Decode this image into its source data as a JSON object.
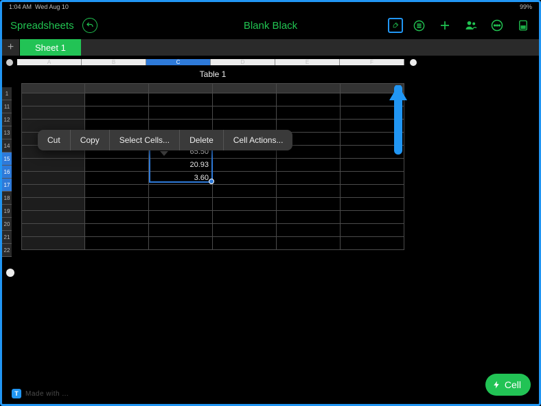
{
  "status": {
    "time": "1:04 AM",
    "date": "Wed Aug 10",
    "battery": "99%"
  },
  "toolbar": {
    "back_label": "Spreadsheets",
    "doc_title": "Blank Black",
    "icons": {
      "undo": "undo-icon",
      "brush": "brush-icon",
      "list": "list-icon",
      "add": "add-icon",
      "collab": "collab-icon",
      "more": "more-icon",
      "panel": "panel-icon"
    }
  },
  "sheet_tabs": {
    "add_label": "+",
    "tabs": [
      "Sheet 1"
    ]
  },
  "table": {
    "title": "Table 1"
  },
  "columns": [
    "A",
    "B",
    "C",
    "D",
    "E",
    "F"
  ],
  "active_column_index": 2,
  "rows": [
    "1",
    "11",
    "12",
    "13",
    "14",
    "15",
    "16",
    "17",
    "18",
    "19",
    "20",
    "21",
    "22"
  ],
  "active_row_indices": [
    5,
    6,
    7
  ],
  "cells": {
    "C15": "65.50",
    "C16": "20.93",
    "C17": "3.60"
  },
  "selection": {
    "col": "C",
    "start_row": "15",
    "end_row": "17"
  },
  "context_menu": [
    "Cut",
    "Copy",
    "Select Cells...",
    "Delete",
    "Cell Actions..."
  ],
  "fab": {
    "label": "Cell",
    "icon": "bolt-icon"
  },
  "corner_badge": {
    "letter": "T",
    "text": "Made with ..."
  }
}
